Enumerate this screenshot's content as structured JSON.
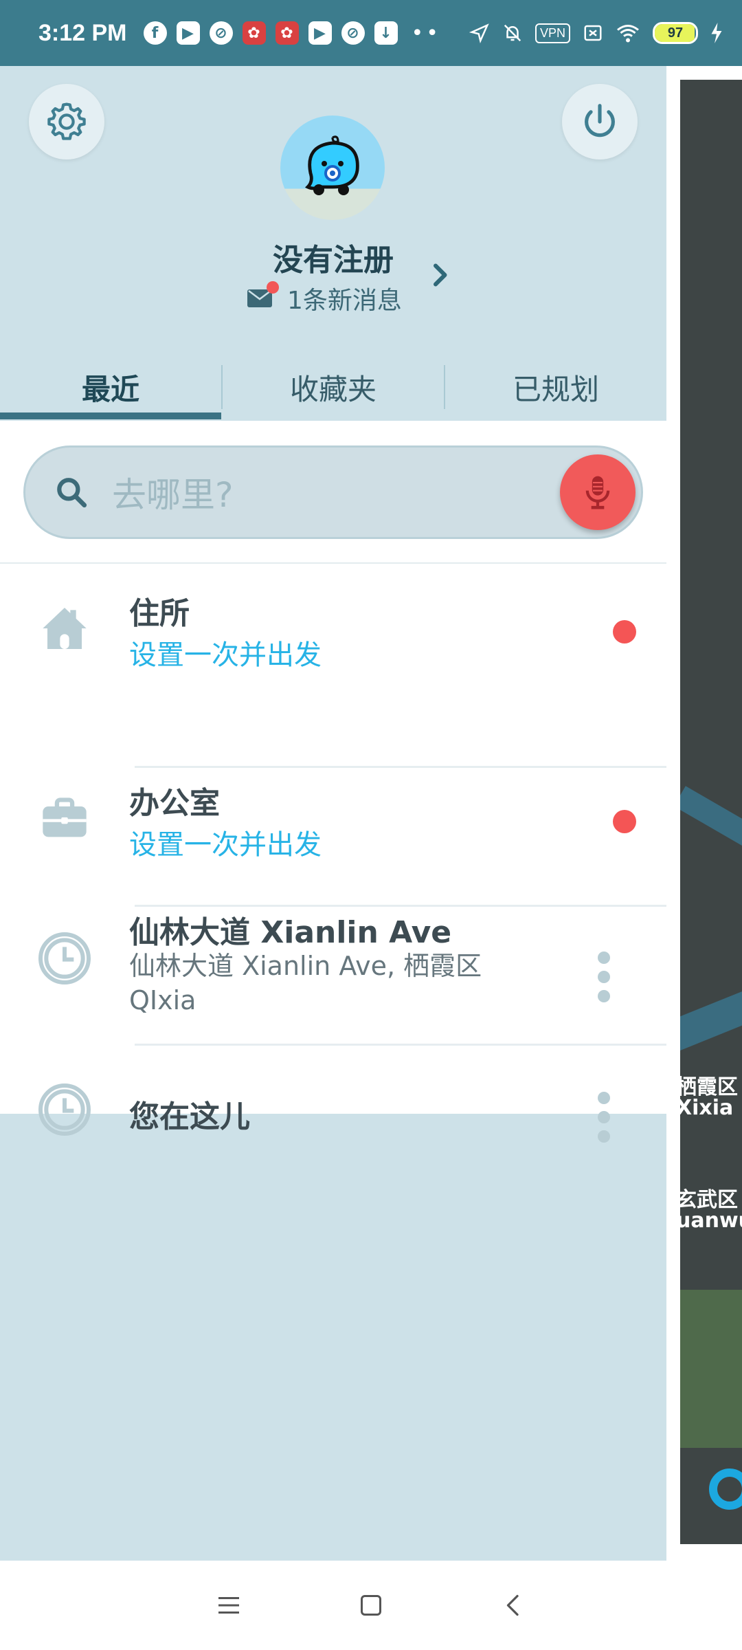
{
  "status_bar": {
    "time": "3:12 PM",
    "vpn_label": "VPN",
    "battery_percent": "97",
    "battery_fill": 0.97
  },
  "drawer": {
    "user_name": "没有注册",
    "message_text": "1条新消息"
  },
  "tabs": [
    {
      "label": "最近",
      "active": true
    },
    {
      "label": "收藏夹",
      "active": false
    },
    {
      "label": "已规划",
      "active": false
    }
  ],
  "search": {
    "placeholder": "去哪里?"
  },
  "places": [
    {
      "title": "住所",
      "subtitle": "设置一次并出发",
      "icon": "home-icon"
    },
    {
      "title": "办公室",
      "subtitle": "设置一次并出发",
      "icon": "briefcase-icon"
    },
    {
      "title": "仙林大道 Xianlin Ave",
      "address": "仙林大道 Xianlin Ave, 栖霞区 QIxia",
      "icon": "clock-icon"
    },
    {
      "title": "您在这儿",
      "icon": "clock-icon"
    }
  ],
  "map": {
    "label_1a": "栖霞区",
    "label_1b": "Xixia",
    "label_2a": "玄武区",
    "label_2b": "uanwu"
  },
  "colors": {
    "status_bar": "#3c7c8d",
    "drawer_bg": "#cde1e8",
    "accent_blue": "#27b3e6",
    "alert_red": "#f45555"
  }
}
